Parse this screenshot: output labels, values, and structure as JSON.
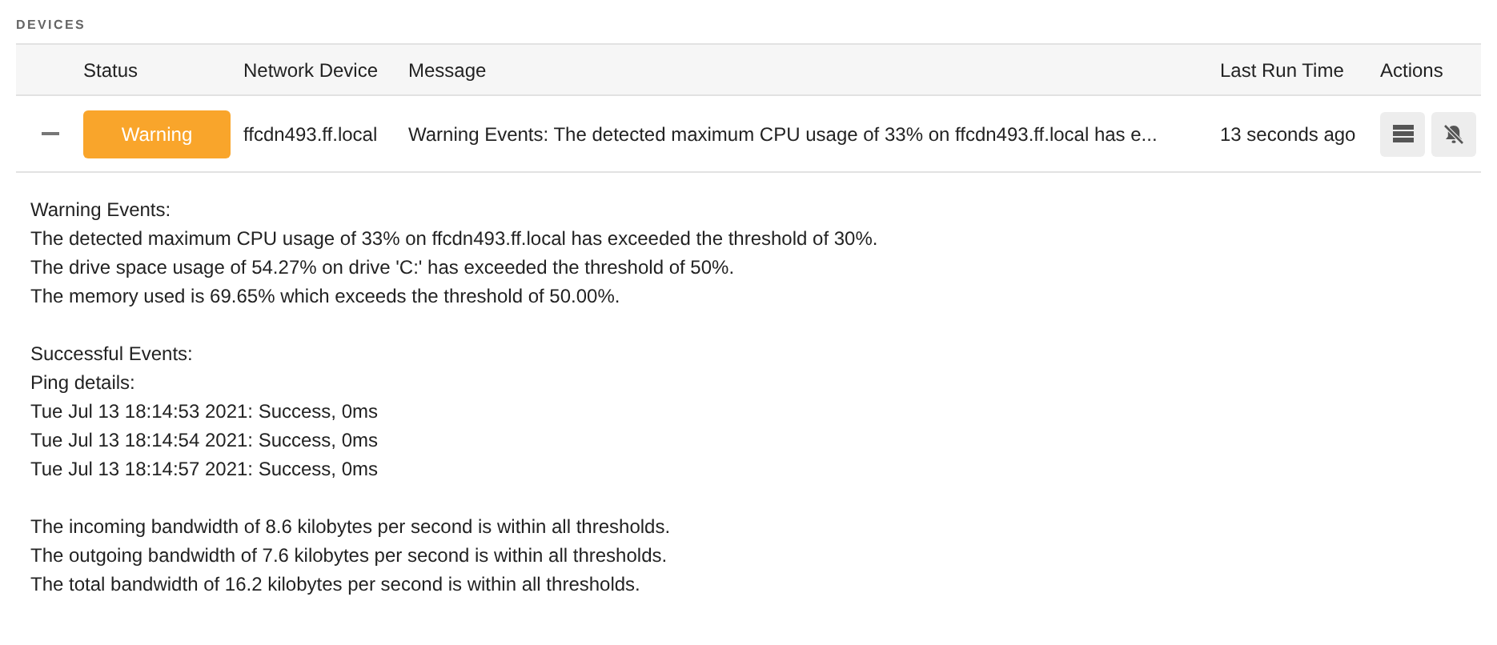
{
  "section_title": "DEVICES",
  "table": {
    "columns": [
      "Status",
      "Network Device",
      "Message",
      "Last Run Time",
      "Actions"
    ],
    "rows": [
      {
        "expanded": true,
        "status": {
          "kind": "warning",
          "label": "Warning"
        },
        "device": "ffcdn493.ff.local",
        "message": "Warning Events: The detected maximum CPU usage of 33% on ffcdn493.ff.local has e...",
        "last_run": "13 seconds ago",
        "actions": [
          {
            "kind": "list"
          },
          {
            "kind": "mute"
          }
        ],
        "details": [
          {
            "lines": [
              "Warning Events:",
              "The detected maximum CPU usage of 33% on ffcdn493.ff.local has exceeded the threshold of 30%.",
              "The drive space usage of 54.27% on drive 'C:' has exceeded the threshold of 50%.",
              "The memory used is 69.65% which exceeds the threshold of 50.00%."
            ]
          },
          {
            "lines": [
              "Successful Events:",
              "Ping details:",
              "Tue Jul 13 18:14:53 2021: Success, 0ms",
              "Tue Jul 13 18:14:54 2021: Success, 0ms",
              "Tue Jul 13 18:14:57 2021: Success, 0ms"
            ]
          },
          {
            "lines": [
              "The incoming bandwidth of 8.6 kilobytes per second is within all thresholds.",
              "The outgoing bandwidth of 7.6 kilobytes per second is within all thresholds.",
              "The total bandwidth of 16.2 kilobytes per second is within all thresholds."
            ]
          }
        ]
      }
    ]
  }
}
